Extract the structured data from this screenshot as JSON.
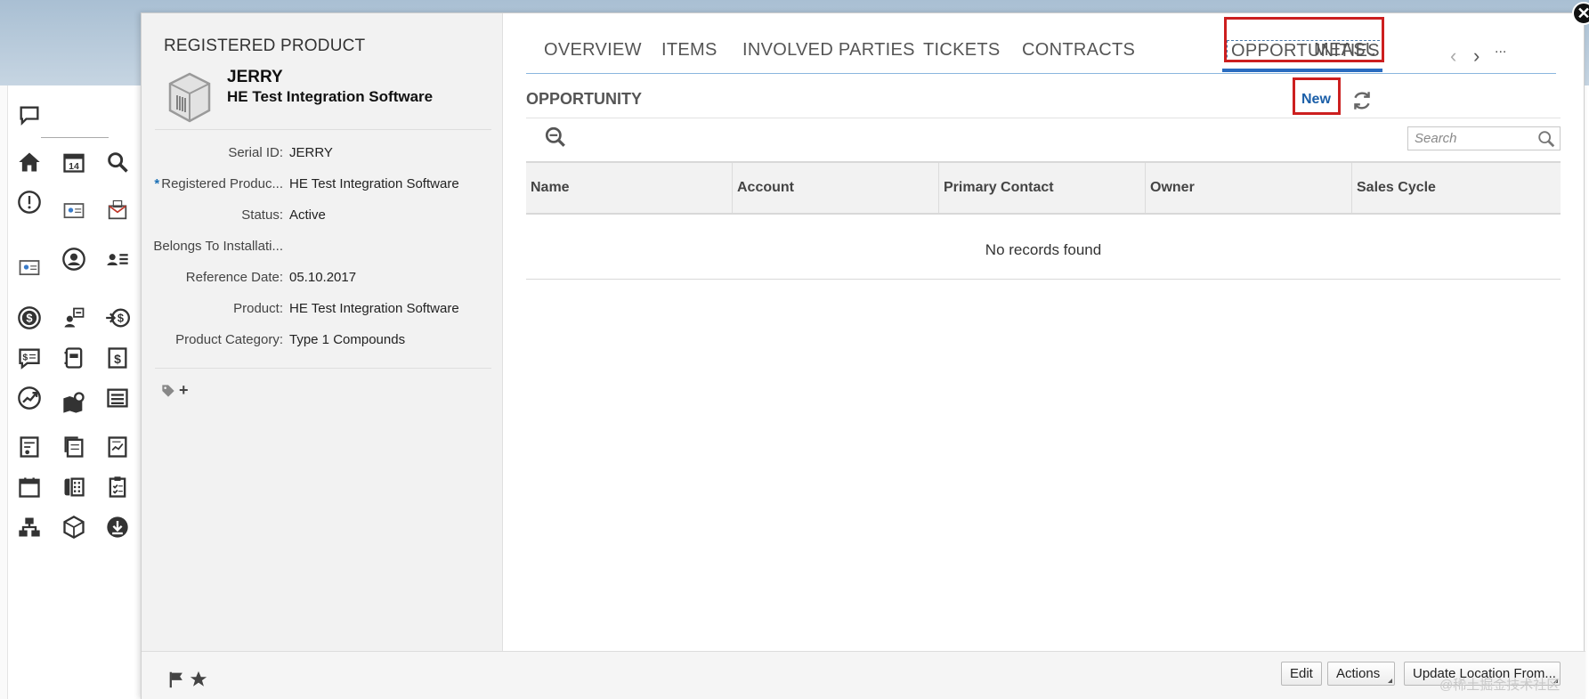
{
  "record": {
    "type_title": "REGISTERED PRODUCT",
    "name": "JERRY",
    "subtitle": "HE Test Integration Software",
    "fields": [
      {
        "label": "Serial ID:",
        "value": "JERRY",
        "required": false
      },
      {
        "label": "Registered Produc...",
        "value": "HE Test Integration Software",
        "required": true
      },
      {
        "label": "Status:",
        "value": "Active",
        "required": false
      },
      {
        "label": "Belongs To Installati...",
        "value": "",
        "required": false
      },
      {
        "label": "Reference Date:",
        "value": "05.10.2017",
        "required": false
      },
      {
        "label": "Product:",
        "value": "HE Test Integration Software",
        "required": false
      },
      {
        "label": "Product Category:",
        "value": "Type 1 Compounds",
        "required": false
      }
    ],
    "required_marker": "*",
    "tag_add": "+"
  },
  "tabs": [
    {
      "label": "OVERVIEW"
    },
    {
      "label": "ITEMS"
    },
    {
      "label": "INVOLVED PARTIES"
    },
    {
      "label": "TICKETS"
    },
    {
      "label": "CONTRACTS"
    },
    {
      "label": "OPPORTUNITIES",
      "active": true
    },
    {
      "label": "MEASU"
    }
  ],
  "tab_nav": {
    "prev": "‹",
    "next": "›",
    "more": "..."
  },
  "section": {
    "title": "OPPORTUNITY",
    "new_label": "New",
    "search_placeholder": "Search"
  },
  "table": {
    "columns": [
      "Name",
      "Account",
      "Primary Contact",
      "Owner",
      "Sales Cycle"
    ],
    "empty_text": "No records found"
  },
  "footer": {
    "edit_label": "Edit",
    "actions_label": "Actions",
    "update_label": "Update Location From..."
  },
  "close_symbol": "✕",
  "watermark": "@稀土掘金技术社区",
  "colors": {
    "highlight": "#cc1f1f",
    "link": "#1b5fa8",
    "tab_underline": "#2a6cc0"
  },
  "nav_icons": [
    "chat-icon",
    "home-icon",
    "calendar-icon",
    "search-icon",
    "alert-icon",
    "contact-card-icon",
    "mail-icon",
    "id-card-icon",
    "user-circle-icon",
    "user-list-icon",
    "dollar-circle-icon",
    "transfer-user-icon",
    "arrow-dollar-icon",
    "dollar-chat-icon",
    "notebook-icon",
    "dollar-doc-icon",
    "growth-icon",
    "map-pin-icon",
    "list-icon",
    "report-icon",
    "pages-icon",
    "chart-doc-icon",
    "calendar-icon",
    "phone-icon",
    "checklist-icon",
    "hierarchy-icon",
    "package-icon",
    "download-icon"
  ]
}
